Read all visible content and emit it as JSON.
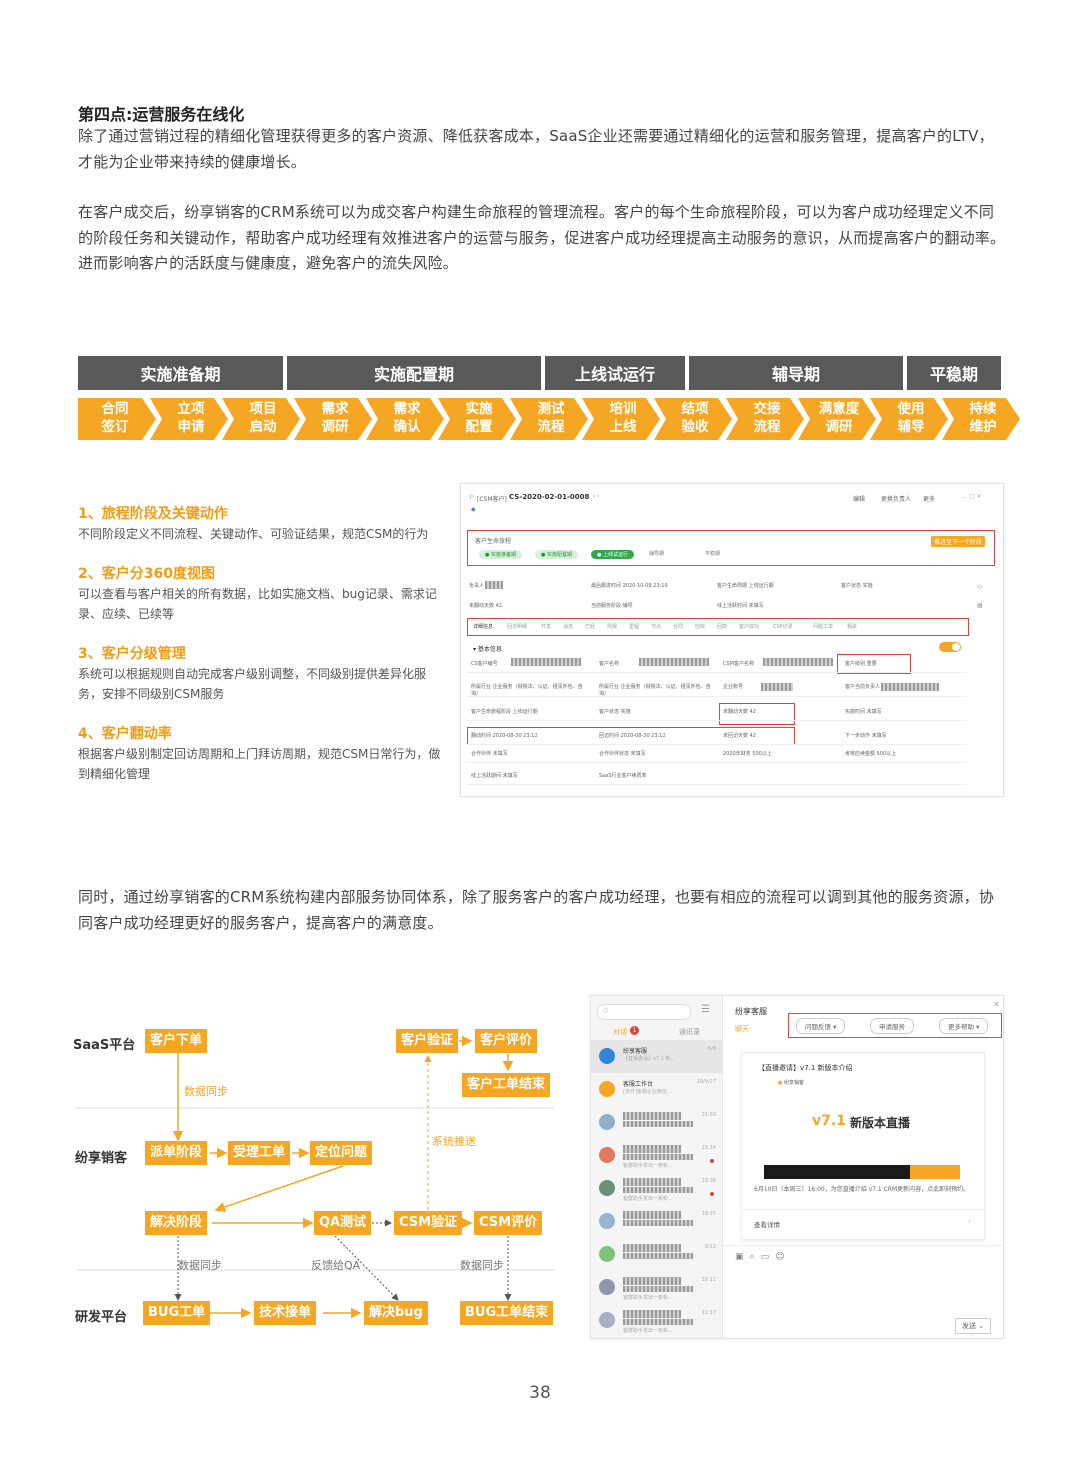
{
  "section_title": "第四点:运营服务在线化",
  "paragraphs": [
    "除了通过营销过程的精细化管理获得更多的客户资源、降低获客成本，SaaS企业还需要通过精细化的运营和服务管理，提高客户的LTV，才能为企业带来持续的健康增长。",
    "在客户成交后，纷享销客的CRM系统可以为成交客户构建生命旅程的管理流程。客户的每个生命旅程阶段，可以为客户成功经理定义不同的阶段任务和关键动作，帮助客户成功经理有效推进客户的运营与服务，促进客户成功经理提高主动服务的意识，从而提高客户的翻动率。进而影响客户的活跃度与健康度，避免客户的流失风险。",
    "同时，通过纷享销客的CRM系统构建内部服务协同体系，除了服务客户的客户成功经理，也要有相应的流程可以调到其他的服务资源，协同客户成功经理更好的服务客户，提高客户的满意度。"
  ],
  "phases": [
    "实施准备期",
    "实施配置期",
    "上线试运行",
    "辅导期",
    "平稳期"
  ],
  "steps": [
    [
      "合同",
      "签订"
    ],
    [
      "立项",
      "申请"
    ],
    [
      "项目",
      "启动"
    ],
    [
      "需求",
      "调研"
    ],
    [
      "需求",
      "确认"
    ],
    [
      "实施",
      "配置"
    ],
    [
      "测试",
      "流程"
    ],
    [
      "培训",
      "上线"
    ],
    [
      "结项",
      "验收"
    ],
    [
      "交接",
      "流程"
    ],
    [
      "满意度",
      "调研"
    ],
    [
      "使用",
      "辅导"
    ],
    [
      "持续",
      "维护"
    ]
  ],
  "features": [
    {
      "title": "1、旅程阶段及关键动作",
      "desc": "不同阶段定义不同流程、关键动作、可验证结果，规范CSM的行为"
    },
    {
      "title": "2、客户分360度视图",
      "desc": "可以查看与客户相关的所有数据，比如实施文档、bug记录、需求记录、应续、已续等"
    },
    {
      "title": "3、客户分级管理",
      "desc": "系统可以根据规则自动完成客户级别调整，不同级别提供差异化服 务，安排不同级别CSM服务"
    },
    {
      "title": "4、客户翻动率",
      "desc": "根据客户级别制定回访周期和上门拜访周期，规范CSM日常行为，做到精细化管理"
    }
  ],
  "crm": {
    "breadcrumb": "[CSM客户]",
    "record_id": "CS-2020-02-01-0008",
    "actions": [
      "编辑",
      "更换负责人",
      "更多"
    ],
    "journey_title": "客户生命旅程",
    "journey_action": "推进至下一个阶段",
    "stages": [
      "实施准备期",
      "实施配置期",
      "上线试运行",
      "辅导期",
      "平稳期"
    ],
    "info_row1": [
      [
        "负责人",
        ""
      ],
      [
        "最后跟进时间",
        "2020-10-08 23:19"
      ],
      [
        "客户生命周期",
        "上线运行期"
      ],
      [
        "客户状态",
        "实施"
      ]
    ],
    "info_row2": [
      [
        "未翻动天数",
        "42"
      ],
      [
        "当前服务阶段",
        "辅导"
      ],
      [
        "线上活跃时间",
        "未填写"
      ]
    ],
    "tabs": [
      "详细信息",
      "回访明细",
      "开发",
      "消息",
      "已经",
      "周报",
      "里程",
      "节点",
      "合同",
      "应收",
      "回款",
      "客户成功",
      "CSP记录",
      "问题工单",
      "相关"
    ],
    "basic_title": "基本信息",
    "fields": [
      [
        "CS客户编号",
        "客户名称",
        "CSM客户名称",
        "客户级别",
        "重要"
      ],
      [
        "所属行业",
        "企业服务（财税法、认证、租赁外包、咨询）",
        "所属行业",
        "企业账号",
        "客户当前负责人"
      ],
      [
        "客户生命旅程阶段",
        "上线运行期",
        "客户状态",
        "实施",
        "未翻动天数",
        "42",
        "实施时间",
        "未填写"
      ],
      [
        "翻动时间",
        "2020-08-30 23:12",
        "回访时间",
        "2020-08-30 23:12",
        "未回访天数",
        "42",
        "下一步动作",
        "未填写"
      ],
      [
        "合作伙伴",
        "未填写",
        "合作伙伴状态",
        "未填写",
        "2020年财务",
        "500以上",
        "考核应续金额",
        "500以上"
      ],
      [
        "线上活跃期间",
        "未填写",
        "SaaS行业客户续费率"
      ]
    ]
  },
  "flow": {
    "lanes": [
      "SaaS平台",
      "纷享销客",
      "研发平台"
    ],
    "boxes": {
      "order": "客户下单",
      "verify": "客户验证",
      "rate": "客户评价",
      "close": "客户工单结束",
      "dispatch": "派单阶段",
      "accept": "受理工单",
      "locate": "定位问题",
      "resolve": "解决阶段",
      "qa": "QA测试",
      "csmv": "CSM验证",
      "csmr": "CSM评价",
      "bug": "BUG工单",
      "tech": "技术接单",
      "fix": "解决bug",
      "bugend": "BUG工单结束"
    },
    "labels": {
      "sync1": "数据同步",
      "push": "系统推送",
      "sync2": "数据同步",
      "feedback": "反馈给QA",
      "sync3": "数据同步"
    }
  },
  "chat": {
    "search_placeholder": "",
    "tabs": [
      "对话",
      "通讯录"
    ],
    "tab_badge": "1",
    "header_title": "纷享客服",
    "subtab": "聊天",
    "buttons": [
      "问题反馈",
      "申请服务",
      "更多帮助"
    ],
    "list": [
      {
        "name": "纷享客服",
        "time": "6/8",
        "preview": "【直播邀请】v7.1 新..."
      },
      {
        "name": "客服工作台",
        "time": "19/9/27",
        "preview": "[文件]客服企业微信..."
      },
      {
        "name": "",
        "time": "21:50",
        "preview": ""
      },
      {
        "name": "",
        "time": "23:34",
        "preview": "客群助手发出一条新..."
      },
      {
        "name": "",
        "time": "19:36",
        "preview": "客群助手发出一条新..."
      },
      {
        "name": "",
        "time": "18:25",
        "preview": ""
      },
      {
        "name": "",
        "time": "9/12",
        "preview": ""
      },
      {
        "name": "",
        "time": "16:11",
        "preview": "客群助手发出一条新..."
      },
      {
        "name": "",
        "time": "11:17",
        "preview": "客群助手发出一条新..."
      }
    ],
    "card_title": "【直播邀请】v7.1 新版本介绍",
    "card_brand": "纷享销客",
    "card_version": "v7.1",
    "card_headline": "新版本直播",
    "card_desc": "6月10日（本周三）16:00，为您直播介绍 v7.1 CRM更新内容，点此即刻预约。",
    "card_link": "查看详情",
    "send": "发送"
  },
  "page_number": "38",
  "colors": {
    "orange": "#f5a623",
    "dark_gray": "#595959",
    "red": "#e0433a",
    "title_orange": "#f39c12"
  }
}
